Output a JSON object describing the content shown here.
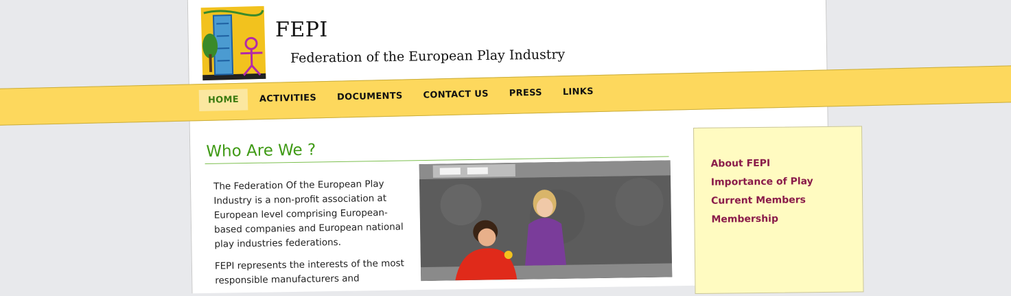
{
  "header": {
    "site_name": "FEPI",
    "tagline": "Federation of the European Play Industry"
  },
  "nav": {
    "items": [
      "HOME",
      "ACTIVITIES",
      "DOCUMENTS",
      "CONTACT US",
      "PRESS",
      "LINKS"
    ],
    "active": "HOME"
  },
  "main": {
    "title": "Who Are We ?",
    "paragraphs": [
      "The Federation Of the European Play Industry is a non-profit association at European level comprising European-based companies and European national play industries federations.",
      "FEPI represents the interests of the most responsible manufacturers and"
    ]
  },
  "sidebar": {
    "links": [
      "About FEPI",
      "Importance of Play",
      "Current Members",
      "Membership"
    ]
  },
  "colors": {
    "nav_band": "#fdd85d",
    "title_green": "#3f9a15",
    "sidebar_bg": "#fffbc1",
    "sidebar_link": "#8a1c4a"
  }
}
